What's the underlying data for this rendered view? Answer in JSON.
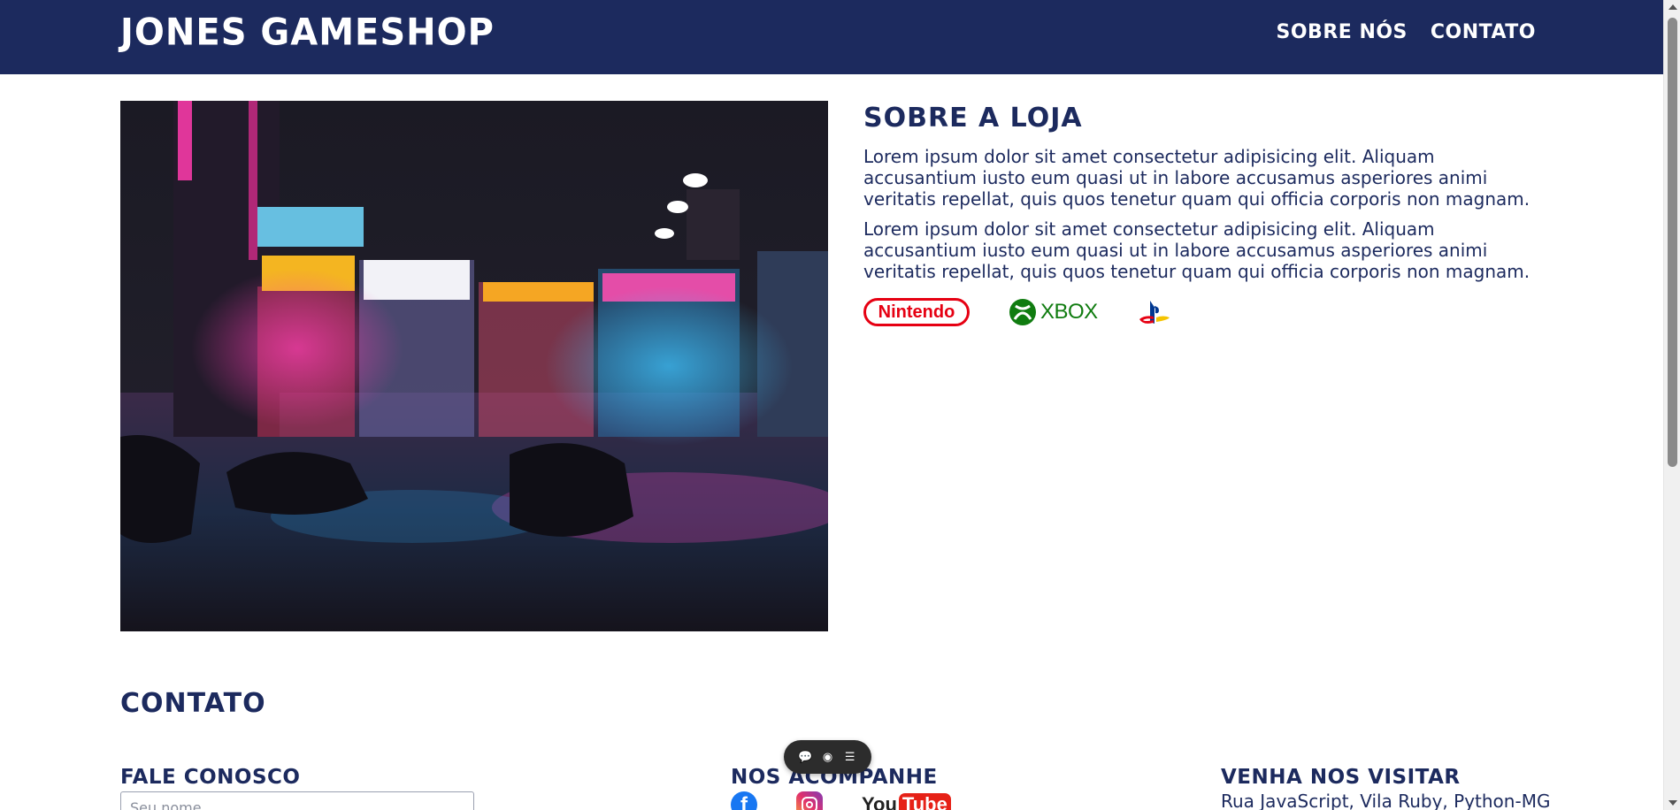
{
  "header": {
    "brand": "JONES GAMESHOP",
    "nav": [
      "SOBRE NÓS",
      "CONTATO"
    ]
  },
  "hero_image": {
    "alt": "night-street-shops-photo"
  },
  "about": {
    "title": "SOBRE A LOJA",
    "paragraphs": [
      "Lorem ipsum dolor sit amet consectetur adipisicing elit. Aliquam accusantium iusto eum quasi ut in labore accusamus asperiores animi veritatis repellat, quis quos tenetur quam qui officia corporis non magnam.",
      "Lorem ipsum dolor sit amet consectetur adipisicing elit. Aliquam accusantium iusto eum quasi ut in labore accusamus asperiores animi veritatis repellat, quis quos tenetur quam qui officia corporis non magnam."
    ],
    "brands": [
      "Nintendo",
      "XBOX",
      "PlayStation"
    ]
  },
  "contact": {
    "title": "CONTATO",
    "form_title": "FALE CONOSCO",
    "name_placeholder": "Seu nome",
    "social_title": "NOS ACOMPANHE",
    "social": [
      "facebook-icon",
      "instagram-icon",
      "youtube-icon"
    ],
    "youtube_text": {
      "you": "You",
      "tube": "Tube"
    },
    "visit_title": "VENHA NOS VISITAR",
    "address": "Rua JavaScript, Vila Ruby, Python-MG"
  },
  "colors": {
    "primary": "#1c2a5e",
    "nintendo": "#e60012",
    "xbox": "#107c10"
  }
}
